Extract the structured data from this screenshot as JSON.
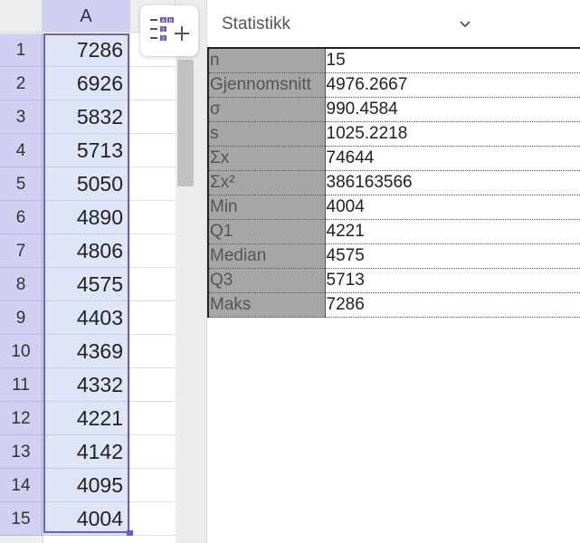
{
  "spreadsheet": {
    "columns": [
      "A"
    ],
    "rows": [
      {
        "row": "1",
        "value": "7286"
      },
      {
        "row": "2",
        "value": "6926"
      },
      {
        "row": "3",
        "value": "5832"
      },
      {
        "row": "4",
        "value": "5713"
      },
      {
        "row": "5",
        "value": "5050"
      },
      {
        "row": "6",
        "value": "4890"
      },
      {
        "row": "7",
        "value": "4806"
      },
      {
        "row": "8",
        "value": "4575"
      },
      {
        "row": "9",
        "value": "4403"
      },
      {
        "row": "10",
        "value": "4369"
      },
      {
        "row": "11",
        "value": "4332"
      },
      {
        "row": "12",
        "value": "4221"
      },
      {
        "row": "13",
        "value": "4142"
      },
      {
        "row": "14",
        "value": "4095"
      },
      {
        "row": "15",
        "value": "4004"
      }
    ]
  },
  "toolbar": {
    "icon": "table-tool-icon",
    "icon_labels": [
      "A",
      "B",
      "1",
      "2"
    ]
  },
  "panel": {
    "title": "Statistikk",
    "dropdown_icon": "chevron-down-icon",
    "stats": [
      {
        "label": "n",
        "value": "15"
      },
      {
        "label": "Gjennomsnitt",
        "value": "4976.2667"
      },
      {
        "label": "σ",
        "value": "990.4584"
      },
      {
        "label": "s",
        "value": "1025.2218"
      },
      {
        "label": "Σx",
        "value": "74644"
      },
      {
        "label": "Σx²",
        "value": "386163566"
      },
      {
        "label": "Min",
        "value": "4004"
      },
      {
        "label": "Q1",
        "value": "4221"
      },
      {
        "label": "Median",
        "value": "4575"
      },
      {
        "label": "Q3",
        "value": "5713"
      },
      {
        "label": "Maks",
        "value": "7286"
      }
    ]
  },
  "colors": {
    "selection": "#6e5fc8",
    "row_header": "#cfd0f2",
    "selected_cell": "#dfe4f6",
    "stat_label_bg": "#a6a6a6"
  }
}
